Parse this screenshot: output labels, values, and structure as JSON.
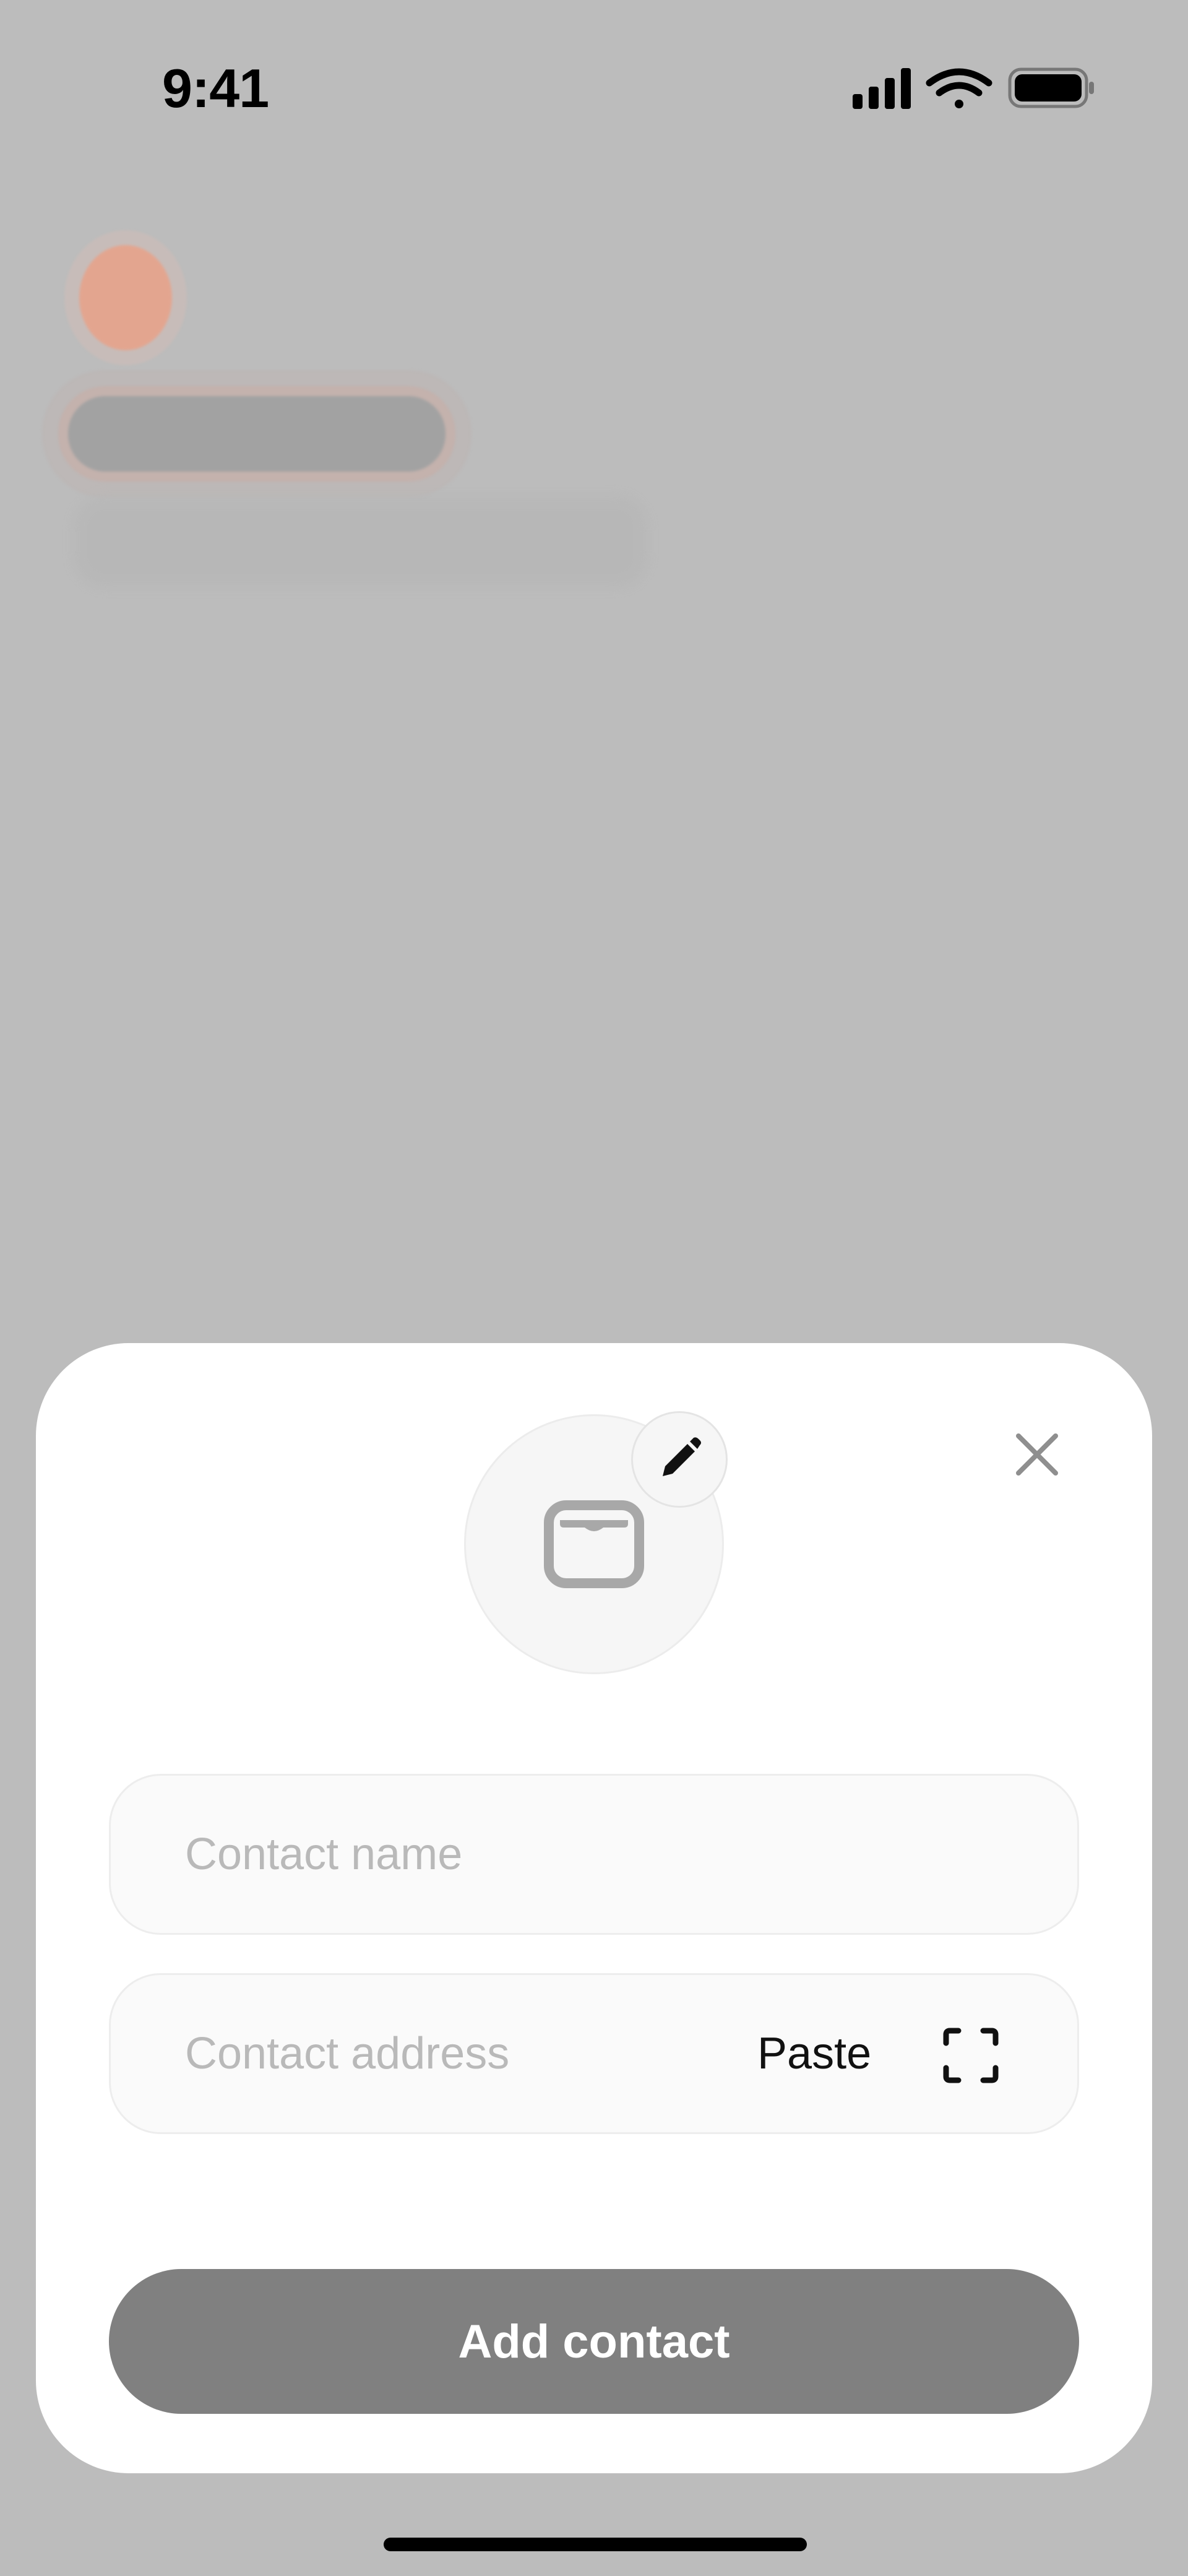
{
  "status_bar": {
    "time": "9:41",
    "icons": [
      "cellular-signal-icon",
      "wifi-icon",
      "battery-icon"
    ]
  },
  "sheet": {
    "avatar_icon": "wallet-icon",
    "edit_icon": "pencil-icon",
    "close_icon": "close-icon",
    "contact_name": {
      "value": "",
      "placeholder": "Contact name"
    },
    "contact_address": {
      "value": "",
      "placeholder": "Contact address",
      "paste_label": "Paste",
      "scan_icon": "scan-qr-icon"
    },
    "add_button_label": "Add contact"
  },
  "colors": {
    "overlay": "#bcbcbc",
    "sheet": "#ffffff",
    "button_disabled": "#808080",
    "placeholder": "#b9b9b9"
  }
}
